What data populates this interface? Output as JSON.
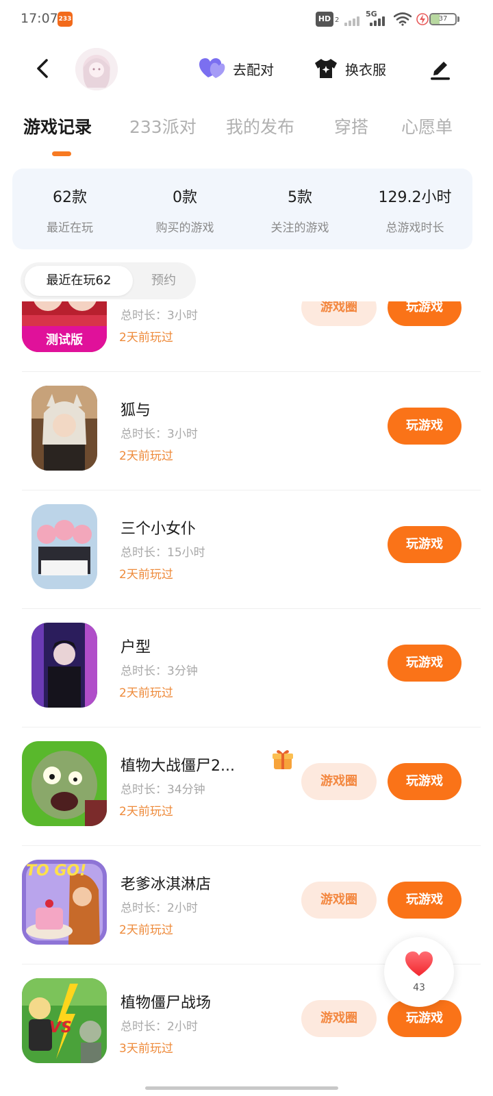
{
  "status_bar": {
    "time": "17:07",
    "app_badge": "233",
    "hd": "HD",
    "hd_sub": "2",
    "network": "5G",
    "battery": 37
  },
  "header": {
    "match_label": "去配对",
    "dress_label": "换衣服",
    "accent_color": "#7b6ff0"
  },
  "tabs": [
    {
      "label": "游戏记录"
    },
    {
      "label": "233派对"
    },
    {
      "label": "我的发布"
    },
    {
      "label": "穿搭"
    },
    {
      "label": "心愿单"
    }
  ],
  "stats": [
    {
      "value": "62款",
      "label": "最近在玩"
    },
    {
      "value": "0款",
      "label": "购买的游戏"
    },
    {
      "value": "5款",
      "label": "关注的游戏"
    },
    {
      "value": "129.2小时",
      "label": "总游戏时长"
    }
  ],
  "filters": {
    "recent": "最近在玩62",
    "reserve": "预约"
  },
  "buttons": {
    "circle": "游戏圈",
    "play": "玩游戏"
  },
  "games": [
    {
      "title": "",
      "duration": "总时长：3小时",
      "last_played": "2天前玩过",
      "thumb_badge": "测试版"
    },
    {
      "title": "狐与",
      "duration": "总时长：3小时",
      "last_played": "2天前玩过"
    },
    {
      "title": "三个小女仆",
      "duration": "总时长：15小时",
      "last_played": "2天前玩过"
    },
    {
      "title": "户型",
      "duration": "总时长：3分钟",
      "last_played": "2天前玩过"
    },
    {
      "title": "植物大战僵尸2...",
      "duration": "总时长：34分钟",
      "last_played": "2天前玩过"
    },
    {
      "title": "老爹冰淇淋店",
      "duration": "总时长：2小时",
      "last_played": "2天前玩过",
      "thumb_text": "TO GO!"
    },
    {
      "title": "植物僵尸战场",
      "duration": "总时长：2小时",
      "last_played": "3天前玩过",
      "thumb_text": "VS"
    }
  ],
  "like_fab": {
    "count": "43"
  }
}
